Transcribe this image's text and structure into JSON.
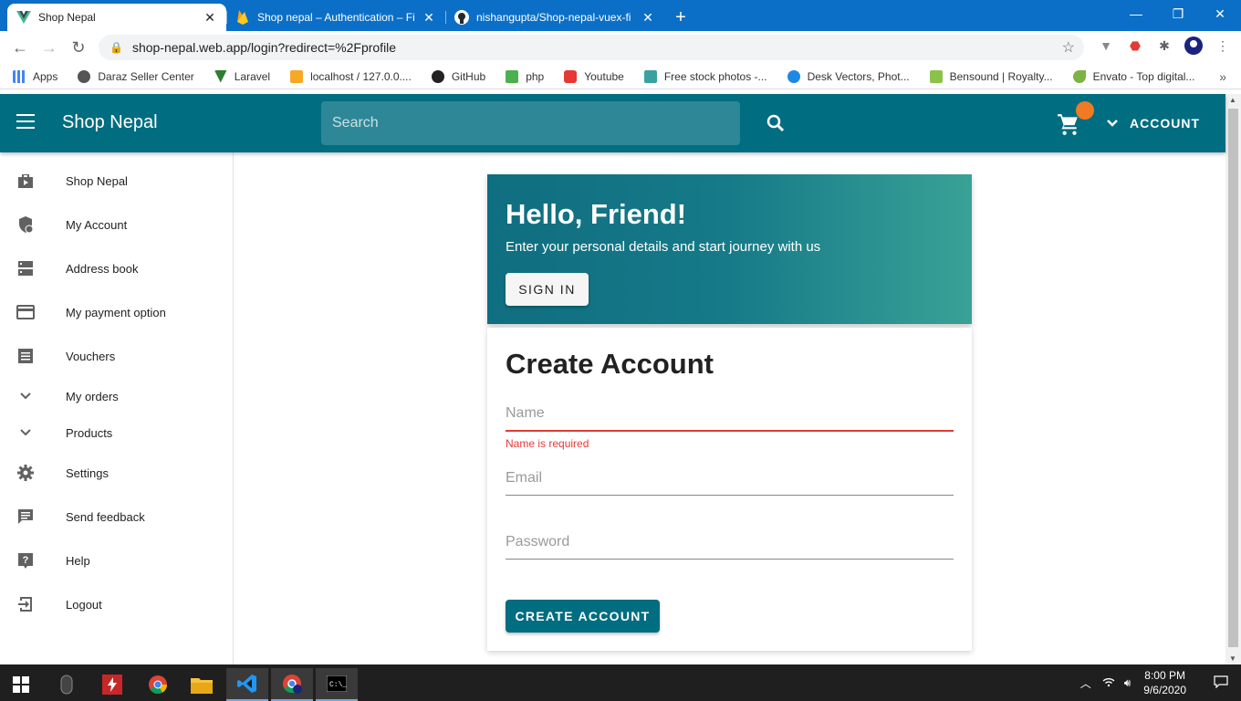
{
  "browser": {
    "tabs": [
      {
        "title": "Shop Nepal",
        "active": true
      },
      {
        "title": "Shop nepal – Authentication – Fi",
        "active": false
      },
      {
        "title": "nishangupta/Shop-nepal-vuex-fi",
        "active": false
      }
    ],
    "url": "shop-nepal.web.app/login?redirect=%2Fprofile",
    "bookmarks": [
      {
        "label": "Apps",
        "color": "#4285f4"
      },
      {
        "label": "Daraz Seller Center",
        "color": "#555555"
      },
      {
        "label": "Laravel",
        "color": "#2e7d32"
      },
      {
        "label": "localhost / 127.0.0....",
        "color": "#f9a825"
      },
      {
        "label": "GitHub",
        "color": "#222222"
      },
      {
        "label": "php",
        "color": "#4caf50"
      },
      {
        "label": "Youtube",
        "color": "#e53935"
      },
      {
        "label": "Free stock photos -...",
        "color": "#3aa1a1"
      },
      {
        "label": "Desk Vectors, Phot...",
        "color": "#1e88e5"
      },
      {
        "label": "Bensound | Royalty...",
        "color": "#8bc34a"
      },
      {
        "label": "Envato - Top digital...",
        "color": "#7cb342"
      }
    ]
  },
  "app": {
    "brand": "Shop Nepal",
    "search_placeholder": "Search",
    "account_label": "ACCOUNT",
    "accent_color": "#006d80",
    "badge_color": "#f07b22"
  },
  "sidebar": {
    "items": [
      {
        "label": "Shop Nepal",
        "icon": "shop-icon"
      },
      {
        "label": "My Account",
        "icon": "account-shield-icon"
      },
      {
        "label": "Address book",
        "icon": "address-book-icon"
      },
      {
        "label": "My payment option",
        "icon": "credit-card-icon"
      },
      {
        "label": "Vouchers",
        "icon": "voucher-icon"
      },
      {
        "label": "My orders",
        "icon": "chevron-down-icon"
      },
      {
        "label": "Products",
        "icon": "chevron-down-icon"
      },
      {
        "label": "Settings",
        "icon": "gear-icon"
      },
      {
        "label": "Send feedback",
        "icon": "feedback-icon"
      },
      {
        "label": "Help",
        "icon": "help-icon"
      },
      {
        "label": "Logout",
        "icon": "logout-icon"
      }
    ]
  },
  "hero": {
    "title": "Hello, Friend!",
    "subtitle": "Enter your personal details and start journey with us",
    "signin_label": "SIGN IN"
  },
  "form": {
    "title": "Create Account",
    "name_placeholder": "Name",
    "name_error": "Name is required",
    "email_placeholder": "Email",
    "password_placeholder": "Password",
    "submit_label": "CREATE ACCOUNT"
  },
  "taskbar": {
    "time": "8:00 PM",
    "date": "9/6/2020"
  }
}
